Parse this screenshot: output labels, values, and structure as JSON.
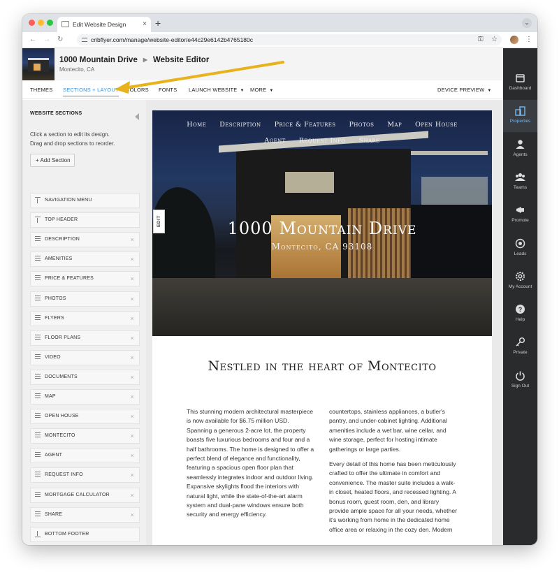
{
  "browser": {
    "tab_title": "Edit Website Design",
    "tab_close": "×",
    "new_tab": "+",
    "url": "cribflyer.com/manage/website-editor/e44c29e6142b4765180c"
  },
  "header": {
    "property_name": "1000 Mountain Drive",
    "section_title": "Website Editor",
    "location": "Montecito, CA"
  },
  "menu": {
    "themes": "THEMES",
    "sections_layout": "SECTIONS + LAYOUT",
    "colors": "COLORS",
    "fonts": "FONTS",
    "launch_website": "LAUNCH WEBSITE",
    "more": "MORE",
    "device_preview": "DEVICE PREVIEW"
  },
  "sidebar": {
    "title": "WEBSITE SECTIONS",
    "help_line1": "Click a section to edit its design.",
    "help_line2": "Drag and drop sections to reorder.",
    "add_section": "+ Add Section",
    "items": [
      {
        "label": "NAVIGATION MENU",
        "icon": "pin-top-icon",
        "removable": false
      },
      {
        "label": "TOP HEADER",
        "icon": "pin-top-icon",
        "removable": false
      },
      {
        "label": "DESCRIPTION",
        "icon": "drag-handle-icon",
        "removable": true
      },
      {
        "label": "AMENITIES",
        "icon": "drag-handle-icon",
        "removable": true
      },
      {
        "label": "PRICE & FEATURES",
        "icon": "drag-handle-icon",
        "removable": true
      },
      {
        "label": "PHOTOS",
        "icon": "drag-handle-icon",
        "removable": true
      },
      {
        "label": "FLYERS",
        "icon": "drag-handle-icon",
        "removable": true
      },
      {
        "label": "FLOOR PLANS",
        "icon": "drag-handle-icon",
        "removable": true
      },
      {
        "label": "VIDEO",
        "icon": "drag-handle-icon",
        "removable": true
      },
      {
        "label": "DOCUMENTS",
        "icon": "drag-handle-icon",
        "removable": true
      },
      {
        "label": "MAP",
        "icon": "drag-handle-icon",
        "removable": true
      },
      {
        "label": "OPEN HOUSE",
        "icon": "drag-handle-icon",
        "removable": true
      },
      {
        "label": "MONTECITO",
        "icon": "drag-handle-icon",
        "removable": true
      },
      {
        "label": "AGENT",
        "icon": "drag-handle-icon",
        "removable": true
      },
      {
        "label": "REQUEST INFO",
        "icon": "drag-handle-icon",
        "removable": true
      },
      {
        "label": "MORTGAGE CALCULATOR",
        "icon": "drag-handle-icon",
        "removable": true
      },
      {
        "label": "SHARE",
        "icon": "drag-handle-icon",
        "removable": true
      },
      {
        "label": "BOTTOM FOOTER",
        "icon": "pin-bottom-icon",
        "removable": false
      }
    ],
    "remove_glyph": "×"
  },
  "preview": {
    "nav": [
      "Home",
      "Description",
      "Price & Features",
      "Photos",
      "Map",
      "Open House",
      "Agent",
      "Request Info",
      "Share"
    ],
    "title": "1000 Mountain Drive",
    "subtitle": "Montecito, CA 93108",
    "edit_tab": "EDIT",
    "heading": "Nestled in the heart of Montecito",
    "col1": [
      "This stunning modern architectural masterpiece is now available for $6.75 million USD. Spanning a generous 2-acre lot, the property boasts five luxurious bedrooms and four and a half bathrooms. The home is designed to offer a perfect blend of elegance and functionality, featuring a spacious open floor plan that seamlessly integrates indoor and outdoor living. Expansive skylights flood the interiors with natural light, while the state-of-the-art alarm system and dual-pane windows ensure both security and energy efficiency."
    ],
    "col2": [
      "countertops, stainless appliances, a butler's pantry, and under-cabinet lighting. Additional amenities include a wet bar, wine cellar, and wine storage, perfect for hosting intimate gatherings or large parties.",
      "Every detail of this home has been meticulously crafted to offer the ultimate in comfort and convenience. The master suite includes a walk-in closet, heated floors, and recessed lighting. A bonus room, guest room, den, and library provide ample space for all your needs, whether it's working from home in the dedicated home office area or relaxing in the cozy den. Modern"
    ]
  },
  "rail": {
    "items": [
      {
        "label": "Dashboard",
        "icon": "dashboard-icon"
      },
      {
        "label": "Properties",
        "icon": "properties-icon",
        "active": true
      },
      {
        "label": "Agents",
        "icon": "agent-icon"
      },
      {
        "label": "Teams",
        "icon": "teams-icon"
      },
      {
        "label": "Promote",
        "icon": "megaphone-icon"
      },
      {
        "label": "Leads",
        "icon": "target-icon"
      },
      {
        "label": "My Account",
        "icon": "gear-icon"
      },
      {
        "label": "Help",
        "icon": "help-icon"
      },
      {
        "label": "Private",
        "icon": "key-icon"
      },
      {
        "label": "Sign Out",
        "icon": "power-icon"
      }
    ]
  },
  "colors": {
    "accent": "#3a8fd6",
    "arrow": "#e8b21c",
    "rail_bg": "#2a2b2d"
  }
}
